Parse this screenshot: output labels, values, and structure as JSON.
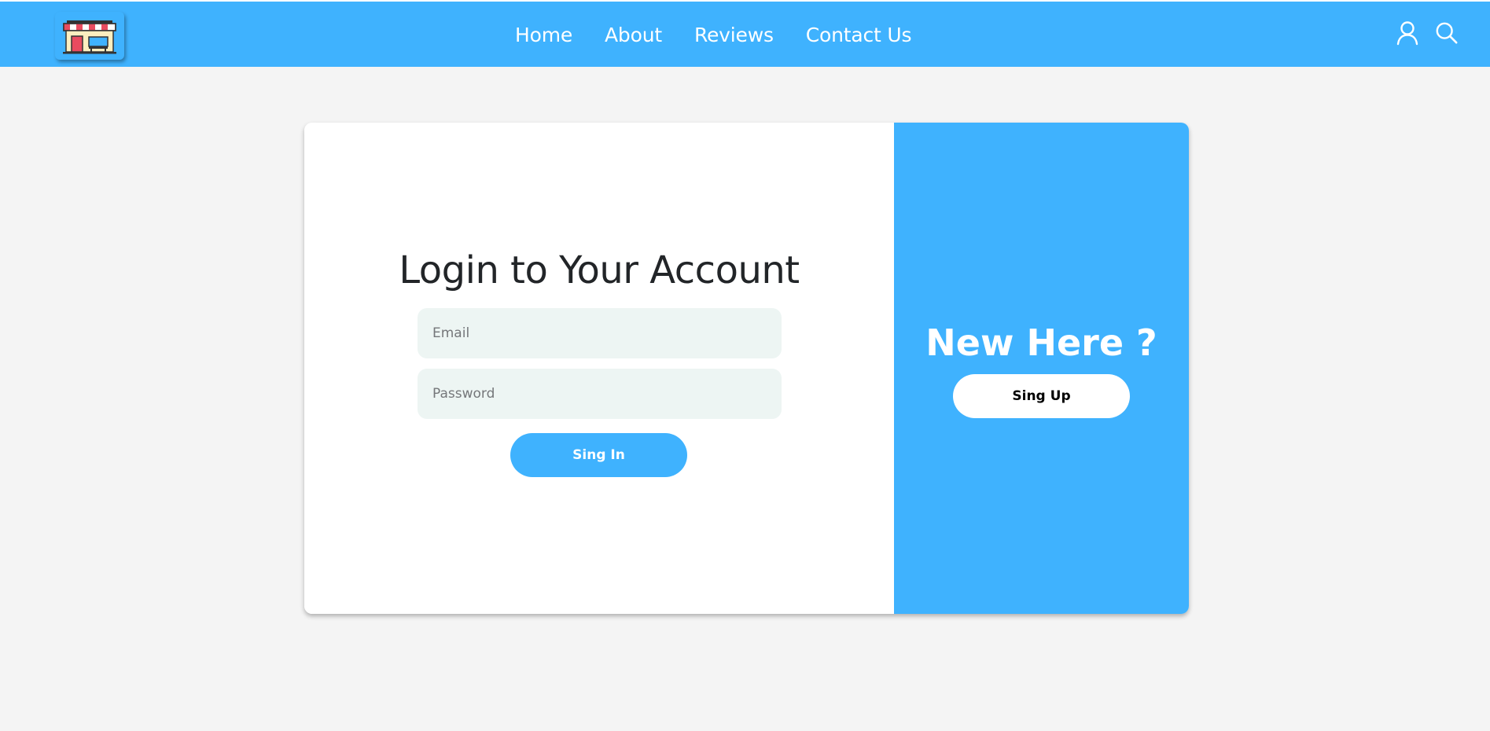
{
  "colors": {
    "accent": "#3fb2fe",
    "page_background": "#f4f4f4",
    "input_background": "#edf5f3",
    "title_text": "#222528"
  },
  "navbar": {
    "logo_icon": "shop-storefront-icon",
    "links": [
      {
        "label": "Home"
      },
      {
        "label": "About"
      },
      {
        "label": "Reviews"
      },
      {
        "label": "Contact Us"
      }
    ],
    "icons": [
      "user-icon",
      "search-icon"
    ]
  },
  "login": {
    "title": "Login to Your Account",
    "email_placeholder": "Email",
    "password_placeholder": "Password",
    "submit_label": "Sing In"
  },
  "signup_panel": {
    "title": "New Here ?",
    "button_label": "Sing Up"
  }
}
